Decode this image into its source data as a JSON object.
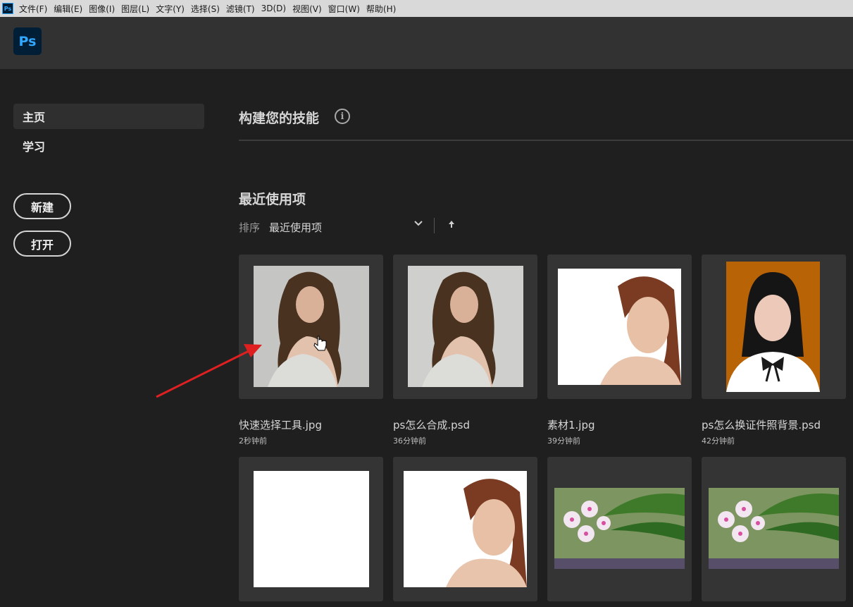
{
  "app_icon": "Ps",
  "menu": [
    "文件(F)",
    "编辑(E)",
    "图像(I)",
    "图层(L)",
    "文字(Y)",
    "选择(S)",
    "滤镜(T)",
    "3D(D)",
    "视图(V)",
    "窗口(W)",
    "帮助(H)"
  ],
  "logo": "Ps",
  "sidebar": {
    "nav": [
      "主页",
      "学习"
    ],
    "new_button": "新建",
    "open_button": "打开"
  },
  "main": {
    "skills_title": "构建您的技能",
    "info_icon": "i",
    "recent_title": "最近使用项",
    "sort_label": "排序",
    "sort_value": "最近使用项",
    "sort_chevron": "chevron-down-icon",
    "sort_direction": "arrow-up-icon"
  },
  "recent_files": [
    {
      "name": "快速选择工具.jpg",
      "time": "2秒钟前"
    },
    {
      "name": "ps怎么合成.psd",
      "time": "36分钟前"
    },
    {
      "name": "素材1.jpg",
      "time": "39分钟前"
    },
    {
      "name": "ps怎么换证件照背景.psd",
      "time": "42分钟前"
    }
  ],
  "colors": {
    "background": "#1f1f1f",
    "titlebar": "#323232",
    "card": "#343434",
    "ps_blue": "#31a8ff",
    "annotation_red": "#e02020"
  }
}
